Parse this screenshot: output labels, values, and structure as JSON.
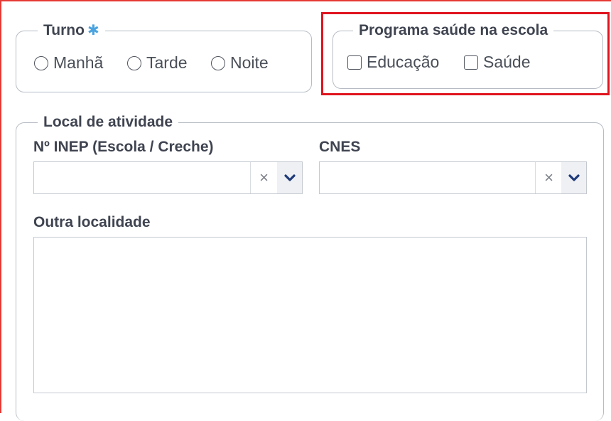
{
  "turno": {
    "legend": "Turno",
    "required_mark": "✱",
    "options": [
      "Manhã",
      "Tarde",
      "Noite"
    ]
  },
  "pse": {
    "legend": "Programa saúde na escola",
    "options": [
      "Educação",
      "Saúde"
    ]
  },
  "local": {
    "legend": "Local de atividade",
    "inep_label": "Nº INEP (Escola / Creche)",
    "cnes_label": "CNES",
    "clear_glyph": "×",
    "outra_label": "Outra localidade"
  },
  "colors": {
    "highlight": "#e0141e",
    "required": "#4aa3df",
    "chevron": "#1e3a78"
  }
}
